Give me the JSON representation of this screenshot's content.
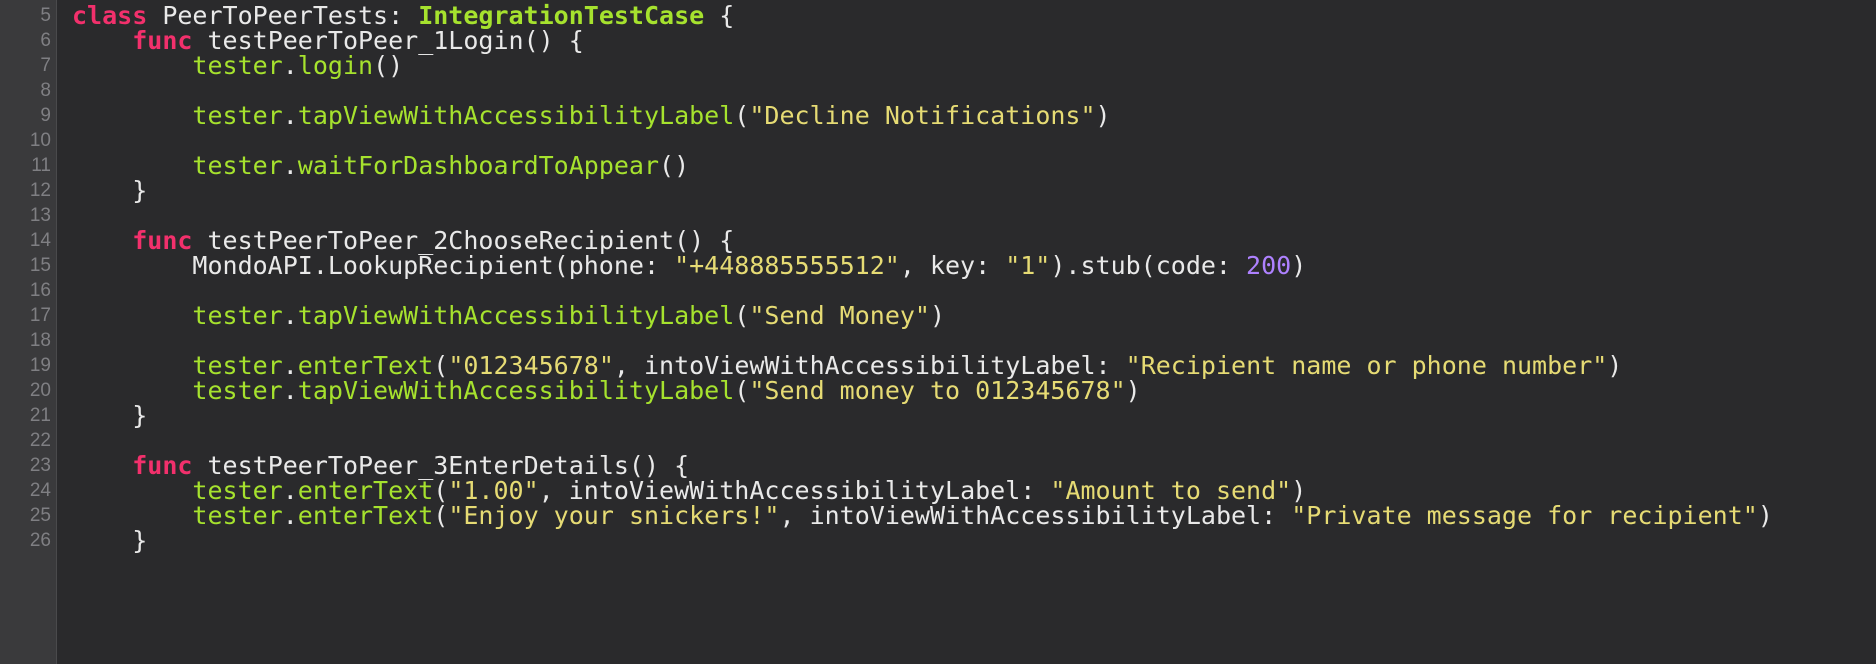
{
  "colors": {
    "background": "#2a2a2c",
    "gutter": "#3a3a3c",
    "line_number": "#7f7f83",
    "plain": "#e9e9e9",
    "keyword": "#f2306c",
    "type": "#a6e22e",
    "method": "#a6e22e",
    "string": "#e6db74",
    "number": "#ae81ff"
  },
  "lines": [
    {
      "num": "5",
      "tokens": [
        {
          "t": "class",
          "c": "kw"
        },
        {
          "t": " PeerToPeerTests: ",
          "c": "pl"
        },
        {
          "t": "IntegrationTestCase",
          "c": "ty"
        },
        {
          "t": " {",
          "c": "pl"
        }
      ]
    },
    {
      "num": "6",
      "tokens": [
        {
          "t": "    ",
          "c": "pl"
        },
        {
          "t": "func",
          "c": "kw"
        },
        {
          "t": " testPeerToPeer_1Login() {",
          "c": "pl"
        }
      ]
    },
    {
      "num": "7",
      "tokens": [
        {
          "t": "        ",
          "c": "pl"
        },
        {
          "t": "tester",
          "c": "fn"
        },
        {
          "t": ".",
          "c": "pl"
        },
        {
          "t": "login",
          "c": "fn"
        },
        {
          "t": "()",
          "c": "pl"
        }
      ]
    },
    {
      "num": "8",
      "tokens": []
    },
    {
      "num": "9",
      "tokens": [
        {
          "t": "        ",
          "c": "pl"
        },
        {
          "t": "tester",
          "c": "fn"
        },
        {
          "t": ".",
          "c": "pl"
        },
        {
          "t": "tapViewWithAccessibilityLabel",
          "c": "fn"
        },
        {
          "t": "(",
          "c": "pl"
        },
        {
          "t": "\"Decline Notifications\"",
          "c": "str"
        },
        {
          "t": ")",
          "c": "pl"
        }
      ]
    },
    {
      "num": "10",
      "tokens": []
    },
    {
      "num": "11",
      "tokens": [
        {
          "t": "        ",
          "c": "pl"
        },
        {
          "t": "tester",
          "c": "fn"
        },
        {
          "t": ".",
          "c": "pl"
        },
        {
          "t": "waitForDashboardToAppear",
          "c": "fn"
        },
        {
          "t": "()",
          "c": "pl"
        }
      ]
    },
    {
      "num": "12",
      "tokens": [
        {
          "t": "    }",
          "c": "pl"
        }
      ]
    },
    {
      "num": "13",
      "tokens": []
    },
    {
      "num": "14",
      "tokens": [
        {
          "t": "    ",
          "c": "pl"
        },
        {
          "t": "func",
          "c": "kw"
        },
        {
          "t": " testPeerToPeer_2ChooseRecipient() {",
          "c": "pl"
        }
      ]
    },
    {
      "num": "15",
      "tokens": [
        {
          "t": "        MondoAPI.LookupRecipient(phone: ",
          "c": "pl"
        },
        {
          "t": "\"+448885555512\"",
          "c": "str"
        },
        {
          "t": ", key: ",
          "c": "pl"
        },
        {
          "t": "\"1\"",
          "c": "str"
        },
        {
          "t": ").stub(code: ",
          "c": "pl"
        },
        {
          "t": "200",
          "c": "num"
        },
        {
          "t": ")",
          "c": "pl"
        }
      ]
    },
    {
      "num": "16",
      "tokens": []
    },
    {
      "num": "17",
      "tokens": [
        {
          "t": "        ",
          "c": "pl"
        },
        {
          "t": "tester",
          "c": "fn"
        },
        {
          "t": ".",
          "c": "pl"
        },
        {
          "t": "tapViewWithAccessibilityLabel",
          "c": "fn"
        },
        {
          "t": "(",
          "c": "pl"
        },
        {
          "t": "\"Send Money\"",
          "c": "str"
        },
        {
          "t": ")",
          "c": "pl"
        }
      ]
    },
    {
      "num": "18",
      "tokens": []
    },
    {
      "num": "19",
      "tokens": [
        {
          "t": "        ",
          "c": "pl"
        },
        {
          "t": "tester",
          "c": "fn"
        },
        {
          "t": ".",
          "c": "pl"
        },
        {
          "t": "enterText",
          "c": "fn"
        },
        {
          "t": "(",
          "c": "pl"
        },
        {
          "t": "\"012345678\"",
          "c": "str"
        },
        {
          "t": ", intoViewWithAccessibilityLabel: ",
          "c": "pl"
        },
        {
          "t": "\"Recipient name or phone number\"",
          "c": "str"
        },
        {
          "t": ")",
          "c": "pl"
        }
      ]
    },
    {
      "num": "20",
      "tokens": [
        {
          "t": "        ",
          "c": "pl"
        },
        {
          "t": "tester",
          "c": "fn"
        },
        {
          "t": ".",
          "c": "pl"
        },
        {
          "t": "tapViewWithAccessibilityLabel",
          "c": "fn"
        },
        {
          "t": "(",
          "c": "pl"
        },
        {
          "t": "\"Send money to 012345678\"",
          "c": "str"
        },
        {
          "t": ")",
          "c": "pl"
        }
      ]
    },
    {
      "num": "21",
      "tokens": [
        {
          "t": "    }",
          "c": "pl"
        }
      ]
    },
    {
      "num": "22",
      "tokens": []
    },
    {
      "num": "23",
      "tokens": [
        {
          "t": "    ",
          "c": "pl"
        },
        {
          "t": "func",
          "c": "kw"
        },
        {
          "t": " testPeerToPeer_3EnterDetails() {",
          "c": "pl"
        }
      ]
    },
    {
      "num": "24",
      "tokens": [
        {
          "t": "        ",
          "c": "pl"
        },
        {
          "t": "tester",
          "c": "fn"
        },
        {
          "t": ".",
          "c": "pl"
        },
        {
          "t": "enterText",
          "c": "fn"
        },
        {
          "t": "(",
          "c": "pl"
        },
        {
          "t": "\"1.00\"",
          "c": "str"
        },
        {
          "t": ", intoViewWithAccessibilityLabel: ",
          "c": "pl"
        },
        {
          "t": "\"Amount to send\"",
          "c": "str"
        },
        {
          "t": ")",
          "c": "pl"
        }
      ]
    },
    {
      "num": "25",
      "tokens": [
        {
          "t": "        ",
          "c": "pl"
        },
        {
          "t": "tester",
          "c": "fn"
        },
        {
          "t": ".",
          "c": "pl"
        },
        {
          "t": "enterText",
          "c": "fn"
        },
        {
          "t": "(",
          "c": "pl"
        },
        {
          "t": "\"Enjoy your snickers!\"",
          "c": "str"
        },
        {
          "t": ", intoViewWithAccessibilityLabel: ",
          "c": "pl"
        },
        {
          "t": "\"Private message for recipient\"",
          "c": "str"
        },
        {
          "t": ")",
          "c": "pl"
        }
      ]
    },
    {
      "num": "26",
      "tokens": [
        {
          "t": "    }",
          "c": "pl"
        }
      ]
    }
  ]
}
